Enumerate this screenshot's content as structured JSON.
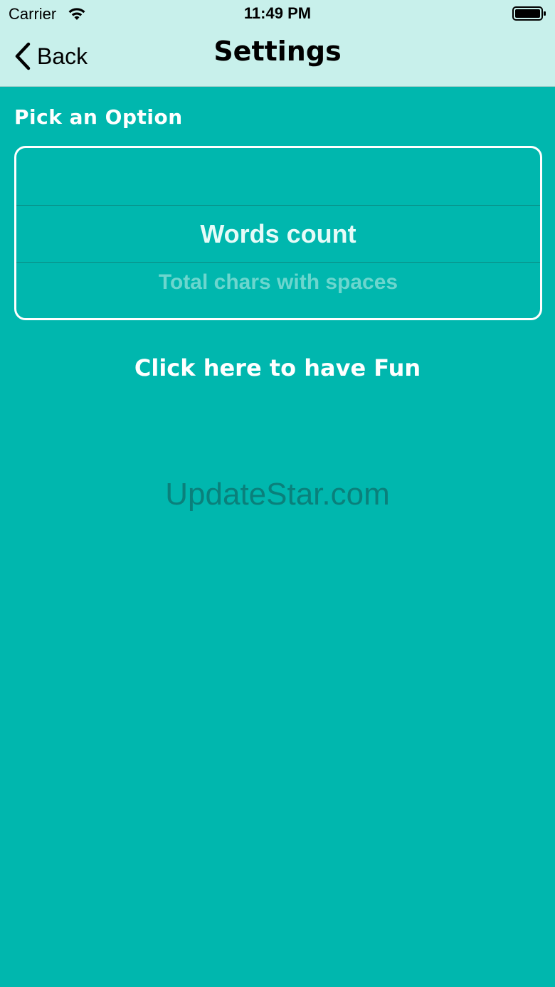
{
  "status_bar": {
    "carrier": "Carrier",
    "time": "11:49 PM",
    "wifi_icon": "wifi-icon",
    "battery_icon": "battery-icon"
  },
  "nav": {
    "back_label": "Back",
    "title": "Settings",
    "back_icon": "chevron-left-icon"
  },
  "picker": {
    "section_label": "Pick an Option",
    "selected": "Words count",
    "next": "Total chars with spaces"
  },
  "fun_button_label": "Click here to have Fun",
  "watermark": "UpdateStar.com",
  "colors": {
    "background": "#00b7ae",
    "topbar": "#c8f0eb",
    "text_on_teal": "#ffffff"
  }
}
